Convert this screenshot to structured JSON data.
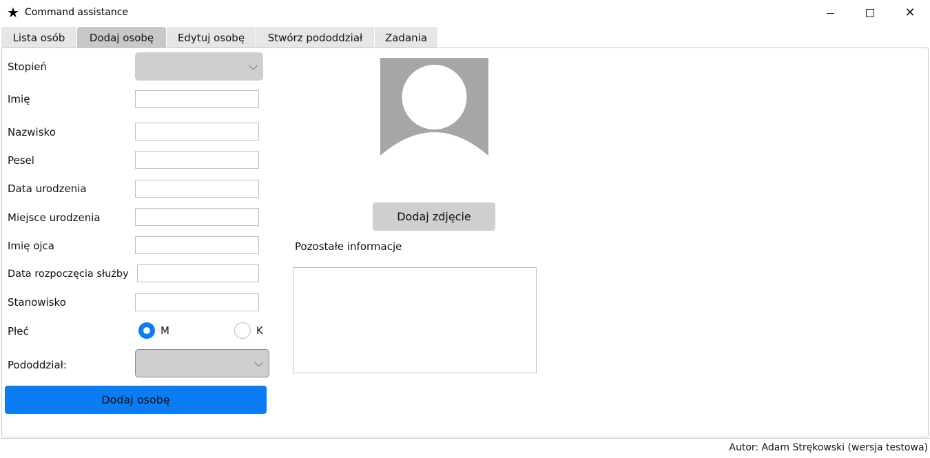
{
  "window": {
    "title": "Command assistance",
    "icon": "star-icon"
  },
  "tabs": [
    {
      "label": "Lista osób"
    },
    {
      "label": "Dodaj osobę"
    },
    {
      "label": "Edytuj osobę"
    },
    {
      "label": "Stwórz pododdział"
    },
    {
      "label": "Zadania"
    }
  ],
  "active_tab": "Dodaj osobę",
  "form": {
    "stopien_label": "Stopień",
    "imie_label": "Imię",
    "nazwisko_label": "Nazwisko",
    "pesel_label": "Pesel",
    "data_urodzenia_label": "Data urodzenia",
    "miejsce_urodzenia_label": "Miejsce urodzenia",
    "imie_ojca_label": "Imię ojca",
    "data_rozpoczecia_label": "Data rozpoczęcia służby",
    "stanowisko_label": "Stanowisko",
    "plec_label": "Płeć",
    "plec_m": "M",
    "plec_k": "K",
    "pododdzial_label": "Pododdział:",
    "submit_label": "Dodaj osobę"
  },
  "photo": {
    "button_label": "Dodaj zdjęcie"
  },
  "other_info": {
    "label": "Pozostałe informacje"
  },
  "status_bar": {
    "text": "Autor: Adam Strękowski (wersja testowa)"
  },
  "colors": {
    "accent": "#0a7df5",
    "combo": "#cfcfcf",
    "avatar": "#a6a6a6"
  }
}
